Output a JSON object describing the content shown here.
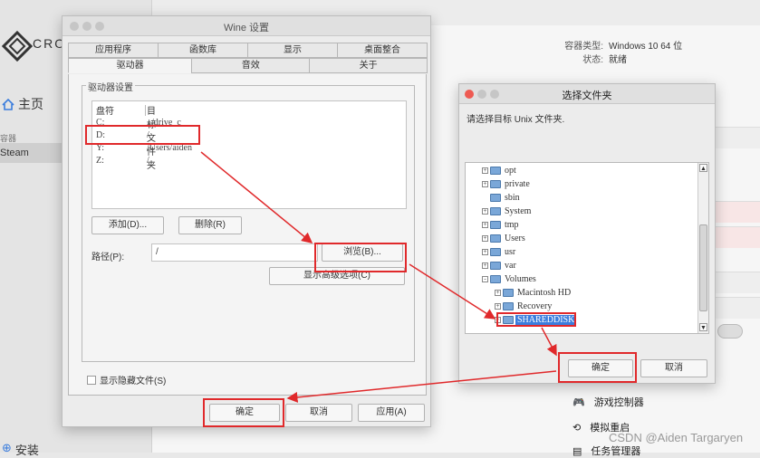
{
  "bg": {
    "logo_text": "CRO",
    "home": "主页",
    "section_label": "容器",
    "steam": "Steam",
    "install": "安装",
    "info_type_label": "容器类型:",
    "info_type_value": "Windows 10 64 位",
    "info_state_label": "状态:",
    "info_state_value": "就绪",
    "game_controllers": "游戏控制器",
    "simulate_restart": "模拟重启",
    "task_manager": "任务管理器",
    "watermark": "CSDN @Aiden Targaryen"
  },
  "wine": {
    "title": "Wine 设置",
    "tabs_top": [
      "应用程序",
      "函数库",
      "显示",
      "桌面整合"
    ],
    "tabs_bottom": [
      "驱动器",
      "音效",
      "关于"
    ],
    "group_title": "驱动器设置",
    "list_header": [
      "盘符",
      "目标文件夹"
    ],
    "drives": [
      {
        "letter": "C:",
        "target": "../drive_c"
      },
      {
        "letter": "D:",
        "target": "/"
      },
      {
        "letter": "Y:",
        "target": "/Users/aiden"
      },
      {
        "letter": "Z:",
        "target": "/"
      }
    ],
    "add_button": "添加(D)...",
    "remove_button": "删除(R)",
    "path_label": "路径(P):",
    "path_value": "/",
    "browse_button": "浏览(B)...",
    "advanced_button": "显示高级选项(C)",
    "show_hidden": "显示隐藏文件(S)",
    "ok_button": "确定",
    "cancel_button": "取消",
    "apply_button": "应用(A)"
  },
  "chooser": {
    "title": "选择文件夹",
    "prompt": "请选择目标 Unix 文件夹.",
    "tree": [
      {
        "label": "opt",
        "expander": "+"
      },
      {
        "label": "private",
        "expander": "+"
      },
      {
        "label": "sbin",
        "expander": ""
      },
      {
        "label": "System",
        "expander": "+"
      },
      {
        "label": "tmp",
        "expander": "+"
      },
      {
        "label": "Users",
        "expander": "+"
      },
      {
        "label": "usr",
        "expander": "+"
      },
      {
        "label": "var",
        "expander": "+"
      },
      {
        "label": "Volumes",
        "expander": "-"
      },
      {
        "label": "Macintosh HD",
        "expander": "+"
      },
      {
        "label": "Recovery",
        "expander": "+"
      },
      {
        "label": "SHAREDDISK",
        "expander": "+"
      }
    ],
    "ok_button": "确定",
    "cancel_button": "取消"
  },
  "colors": {
    "annotation": "#e0292b",
    "selection": "#3b7ddd"
  }
}
